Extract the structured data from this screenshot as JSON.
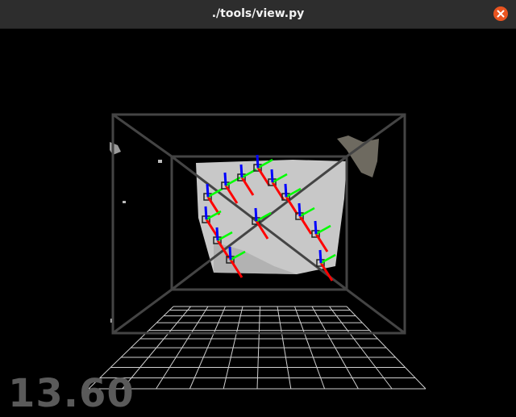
{
  "window": {
    "title": "./tools/view.py",
    "close_icon": "close-icon",
    "accent_color": "#e95420"
  },
  "viewport": {
    "fps_readout": "13.60",
    "background": "#000000",
    "axis_colors": {
      "x": "#ff0000",
      "y": "#00ff00",
      "z": "#0000ff"
    },
    "frame_color": "#444444",
    "grid_color": "#d0d0d0"
  }
}
